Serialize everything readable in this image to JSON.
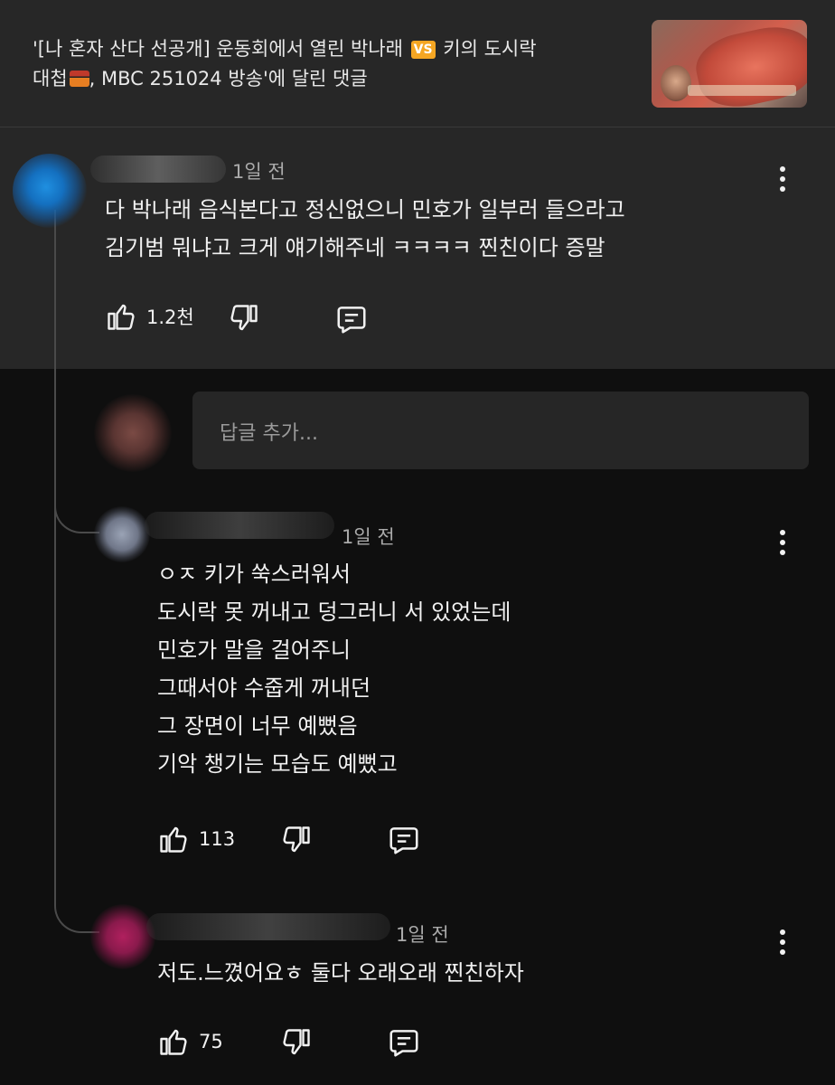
{
  "video": {
    "title_part1": "'[나 혼자 산다 선공개] 운동회에서 열린 박나래 ",
    "vs_badge": "VS",
    "title_part2": " 키의 도시락",
    "title_line2_part1": "대첩",
    "title_line2_part2": ", MBC 251024 방송'에 달린 댓글"
  },
  "comments": [
    {
      "time": "1일 전",
      "text": "다 박나래 음식본다고 정신없으니 민호가 일부러 들으라고\n김기범 뭐냐고 크게 얘기해주네 ㅋㅋㅋㅋ 찐친이다 증말",
      "likes": "1.2천"
    }
  ],
  "reply_input": {
    "placeholder": "답글 추가..."
  },
  "replies": [
    {
      "time": "1일 전",
      "text": "ㅇㅈ 키가 쑥스러워서\n도시락 못 꺼내고 덩그러니 서 있었는데\n민호가 말을 걸어주니\n그때서야 수줍게 꺼내던\n그 장면이 너무 예뻤음\n기악 챙기는 모습도 예뻤고",
      "likes": "113"
    },
    {
      "time": "1일 전",
      "text": "저도.느꼈어요ㅎ 둘다 오래오래 찐친하자",
      "likes": "75"
    }
  ],
  "icons": {
    "like": "thumbs-up-icon",
    "dislike": "thumbs-down-icon",
    "reply": "comment-reply-icon",
    "more": "more-vertical-icon"
  },
  "colors": {
    "background": "#0f0f0f",
    "top_panel": "#272727",
    "vs_badge": "#f5a623"
  }
}
